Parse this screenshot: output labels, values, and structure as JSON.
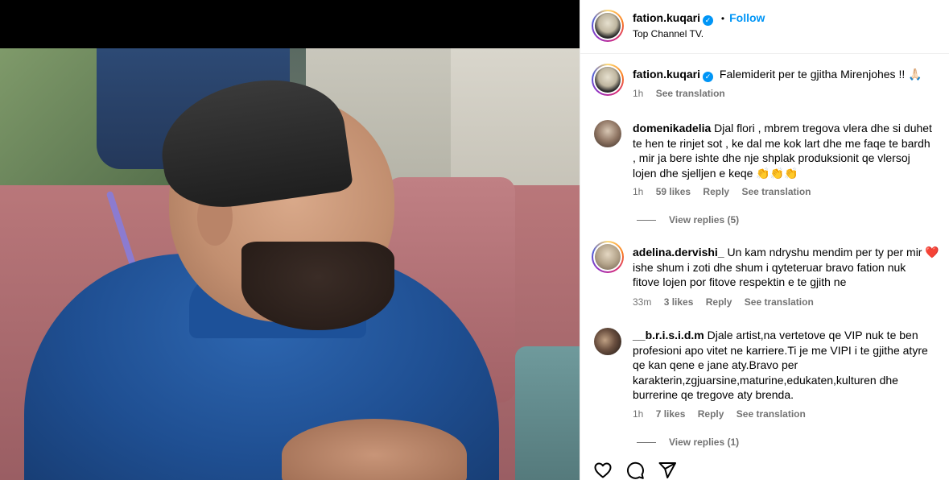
{
  "post": {
    "username": "fation.kuqari",
    "verified": true,
    "follow_label": "Follow",
    "separator": "•",
    "subtitle": "Top Channel TV."
  },
  "caption": {
    "username": "fation.kuqari",
    "text": "Falemiderit per te gjitha Mirenjohes !! 🙏🏻",
    "time": "1h",
    "see_translation": "See translation"
  },
  "comments": [
    {
      "username": "domenikadelia",
      "lines": [
        "Djal flori , mbrem tregova vlera dhe si duhet",
        "te hen te rinjet sot , ke dal me kok lart dhe me faqe te bardh",
        ", mir ja bere ishte dhe nje shplak produksionit qe vlersoj",
        "lojen dhe sjelljen e keqe 👏👏👏"
      ],
      "time": "1h",
      "likes": "59 likes",
      "reply": "Reply",
      "see_translation": "See translation",
      "view_replies": "View replies (5)"
    },
    {
      "username": "adelina.dervishi_",
      "lines": [
        "Un kam ndryshu mendim per ty per mir ❤️",
        "ishe shum i zoti dhe shum i qyteteruar bravo fation nuk",
        "fitove lojen por fitove respektin e te gjith ne"
      ],
      "time": "33m",
      "likes": "3 likes",
      "reply": "Reply",
      "see_translation": "See translation"
    },
    {
      "username": "__b.r.i.s.i.d.m",
      "lines": [
        "Djale artist,na vertetove qe VIP nuk te ben",
        "profesioni apo vitet ne karriere.Ti je me VIPI i te gjithe atyre",
        "qe kan qene e jane aty.Bravo per",
        "karakterin,zgjuarsine,maturine,edukaten,kulturen dhe",
        "burrerine qe tregove aty brenda."
      ],
      "time": "1h",
      "likes": "7 likes",
      "reply": "Reply",
      "see_translation": "See translation",
      "view_replies": "View replies (1)"
    }
  ],
  "icons": {
    "like": "heart-icon",
    "comment": "comment-icon",
    "share": "send-icon",
    "verified": "verified-badge-icon"
  },
  "colors": {
    "accent": "#0095f6",
    "muted": "#737373",
    "border": "#efefef"
  }
}
